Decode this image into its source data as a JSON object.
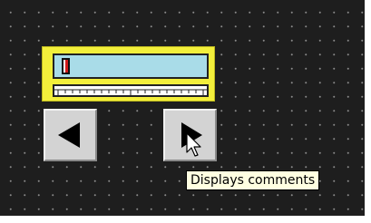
{
  "slider": {
    "value_fraction": 0.02,
    "colors": {
      "frame": "#f3ef3b",
      "track": "#a9dce8",
      "thumb": "#d11b1b"
    }
  },
  "buttons": {
    "left_icon": "left-triangle-icon",
    "right_icon": "right-triangle-icon"
  },
  "cursor": {
    "icon": "arrow-cursor-icon"
  },
  "tooltip": {
    "text": "Displays comments"
  }
}
